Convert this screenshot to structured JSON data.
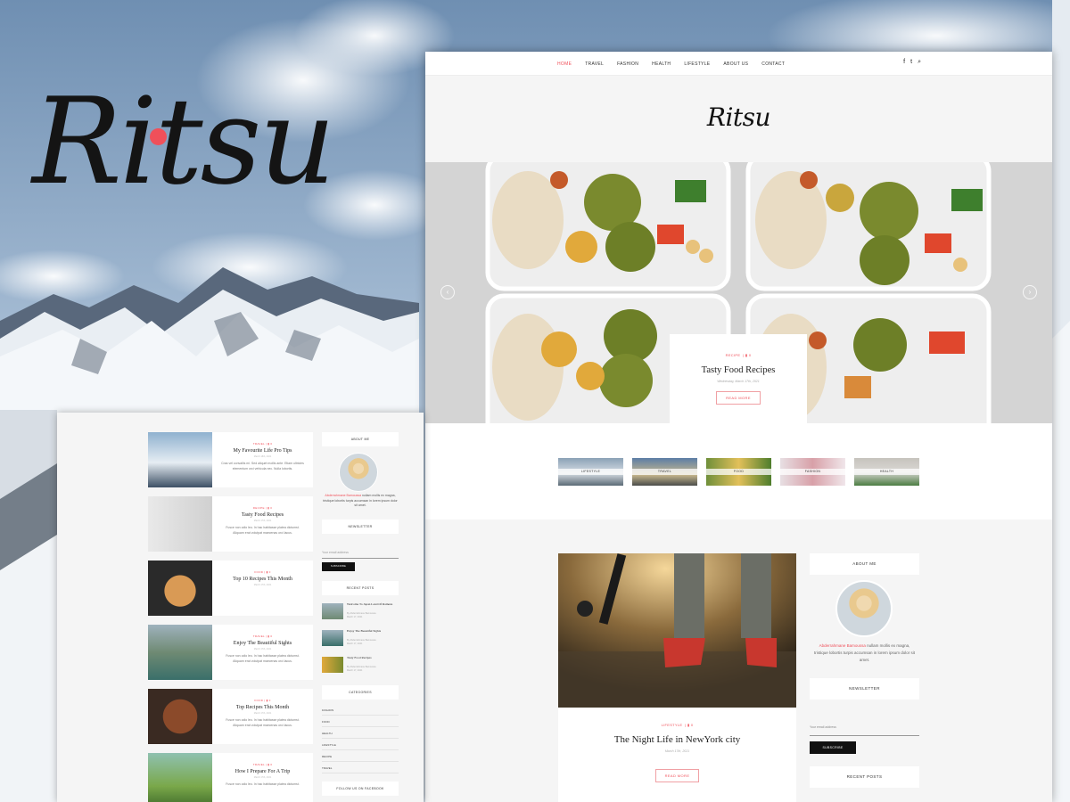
{
  "hero": {
    "logo": "Ritsu"
  },
  "nav": {
    "items": [
      "HOME",
      "TRAVEL",
      "FASHION",
      "HEALTH",
      "LIFESTYLE",
      "ABOUT US",
      "CONTACT"
    ],
    "active_index": 0,
    "icons": [
      "facebook-icon",
      "twitter-icon",
      "search-icon"
    ],
    "icon_glyphs": [
      "f",
      "t",
      "⌕"
    ]
  },
  "main": {
    "logo": "Ritsu",
    "slide": {
      "category": "RECIPE",
      "comments": "0",
      "title": "Tasty Food Recipes",
      "date": "Wednesday, March 17th, 2021",
      "button": "READ MORE"
    },
    "categories": [
      "LIFESTYLE",
      "TRAVEL",
      "FOOD",
      "FASHION",
      "HEALTH"
    ],
    "post": {
      "category": "LIFESTYLE",
      "comments": "0",
      "title": "The Night Life in NewYork city",
      "date": "March 17th, 2021",
      "button": "READ MORE"
    },
    "sidebar": {
      "about_title": "ABOUT ME",
      "about_name": "Abderrahmane Bamoussa",
      "about_text": "nullam mollis ex magna, tristique lobortis turpis accumsan in lorem ipsum dolor sit amet.",
      "newsletter_title": "NEWSLETTER",
      "email_placeholder": "Your email address",
      "subscribe": "SUBSCRIBE",
      "recent_title": "RECENT POSTS"
    }
  },
  "left": {
    "posts": [
      {
        "category": "TRAVEL",
        "comments": "0",
        "title": "My Favourite Life Pro Tips",
        "date": "March 18th, 2021",
        "excerpt": "Cras vel convallis mi. Sed aliquet mollis ante. Etiam ultricies elementum orci vehicula nec. Nulla lobortis."
      },
      {
        "category": "RECIPE",
        "comments": "0",
        "title": "Tasty Food Recipes",
        "date": "March 17th, 2021",
        "excerpt": "Fusce non odio leo. In hac habitasse platea dictumst. Aliquam erat volutpat maecenas orci lacus."
      },
      {
        "category": "FOOD",
        "comments": "0",
        "title": "Top 10 Recipes This Month",
        "date": "March 17th, 2021",
        "excerpt": ""
      },
      {
        "category": "TRAVEL",
        "comments": "0",
        "title": "Enjoy The Beautiful Sights",
        "date": "March 17th, 2021",
        "excerpt": "Fusce non odio leo. In hac habitasse platea dictumst. Aliquam erat volutpat maecenas orci lacus."
      },
      {
        "category": "FOOD",
        "comments": "0",
        "title": "Top Recipes This Month",
        "date": "March 17th, 2021",
        "excerpt": "Fusce non odio leo. In hac habitasse platea dictumst. Aliquam erat volutpat maecenas orci lacus."
      },
      {
        "category": "TRAVEL",
        "comments": "0",
        "title": "How I Prepare For A Trip",
        "date": "March 17th, 2021",
        "excerpt": "Fusce non odio leo. In hac habitasse platea dictumst."
      }
    ],
    "sidebar": {
      "about_title": "ABOUT ME",
      "about_name": "Abderrahmane Bamoussa",
      "about_text": "nullam mollis ex magna, tristique lobortis turpis accumsan in lorem ipsum dolor sit amet.",
      "newsletter_title": "NEWSLETTER",
      "email_placeholder": "Your email address",
      "subscribe": "SUBSCRIBE",
      "recent_title": "RECENT POSTS",
      "recent": [
        {
          "title": "Welcome To Japan Land Of Ramens",
          "author": "By Abderrahmane Bamoussa",
          "date": "March 17, 2021"
        },
        {
          "title": "Enjoy The Beautiful Sights",
          "author": "By Abderrahmane Bamoussa",
          "date": "March 17, 2021"
        },
        {
          "title": "Tasty Food Recipes",
          "author": "By Abderrahmane Bamoussa",
          "date": "March 17, 2021"
        }
      ],
      "categories_title": "CATEGORIES",
      "categories": [
        "FASHION",
        "FOOD",
        "HEALTH",
        "LIFESTYLE",
        "RECIPE",
        "TRAVEL"
      ],
      "follow_title": "FOLLOW US ON FACEBOOK"
    }
  },
  "colors": {
    "accent": "#f0505a",
    "dark": "#111111",
    "panel": "#f5f5f5"
  }
}
